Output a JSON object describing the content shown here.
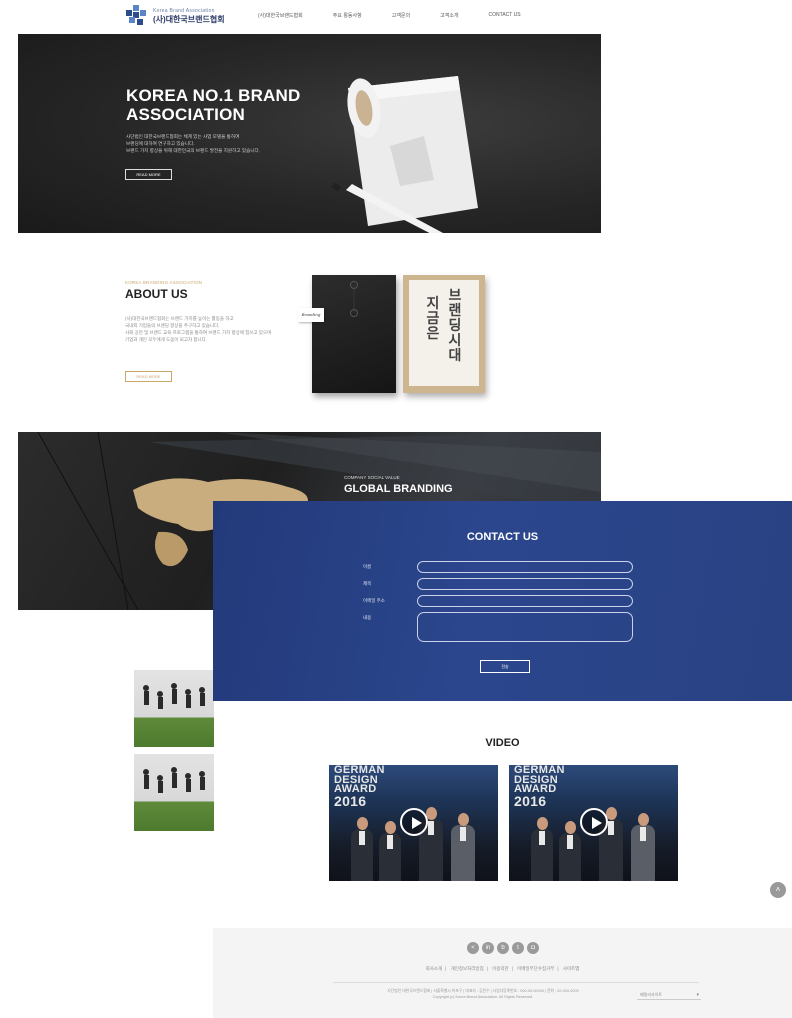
{
  "header": {
    "logo_en": "Korea Brand Association",
    "logo_ko": "(사)대한국브랜드협회",
    "nav": [
      "(사)대한국브랜드협회",
      "주요 활동사항",
      "고객문의",
      "고객소개",
      "CONTACT US"
    ]
  },
  "hero": {
    "title_line1": "KOREA NO.1 BRAND",
    "title_line2": "ASSOCIATION",
    "desc_line1": "사단법인 대한국브랜드협회는 체계 있는 사업 모델을 통하여",
    "desc_line2": "브랜딩에 대하여 연구하고 있습니다.",
    "desc_line3": "브랜드 가치 향상을 위해 대한민국의 브랜드 발전을 지원하고 있습니다.",
    "button": "READ MORE"
  },
  "about": {
    "kicker": "KOREA BRANDING ASSOCIATION",
    "title": "ABOUT US",
    "desc_line1": "(사)대한국브랜드협회는 브랜드 가치를 높이는 활동을 하고",
    "desc_line2": "국내외 기업들의 브랜딩 향상을 추구하고 있습니다.",
    "desc_line3": "사회 공헌 및 브랜드 교육 프로그램을 통하여 브랜드 가치 향상에 힘쓰고 있으며",
    "desc_line4": "기업과 개인 모두에게 도움이 되고자 합니다.",
    "button": "READ MORE",
    "envelope_tag": "Branding",
    "envelope_text_col1": "지금은",
    "envelope_text_col2": "브랜딩시대"
  },
  "global": {
    "kicker": "COMPANY SOCIAL VALUE",
    "title": "GLOBAL BRANDING"
  },
  "contact": {
    "title": "CONTACT US",
    "fields": [
      {
        "label": "이름"
      },
      {
        "label": "제목"
      },
      {
        "label": "이메일 주소"
      },
      {
        "label": "내용"
      }
    ],
    "submit": "전송"
  },
  "video": {
    "title": "VIDEO",
    "items": [
      {
        "award_line1": "GERMAN",
        "award_line2": "DESIGN",
        "award_line3": "AWARD",
        "award_line4": "2016"
      },
      {
        "award_line1": "GERMAN",
        "award_line2": "DESIGN",
        "award_line3": "AWARD",
        "award_line4": "2016"
      }
    ]
  },
  "footer": {
    "social_icons": [
      "share-icon",
      "linkedin-icon",
      "blog-icon",
      "bookmark-icon",
      "instagram-icon"
    ],
    "links": [
      "회사소개",
      "개인정보처리방침",
      "이용약관",
      "이메일무단수집거부",
      "사이트맵"
    ],
    "info_line1": "사단법인 대한국브랜드협회 | 서울특별시 마포구 | 대표자 : 김민수 | 사업자등록번호 : 000-00-00000 | 전화 : 02-000-0000",
    "info_line2": "Copyright (c) Korea Brand Association. All Rights Reserved.",
    "family_site": "패밀리사이트"
  },
  "scroll_top": "˄"
}
